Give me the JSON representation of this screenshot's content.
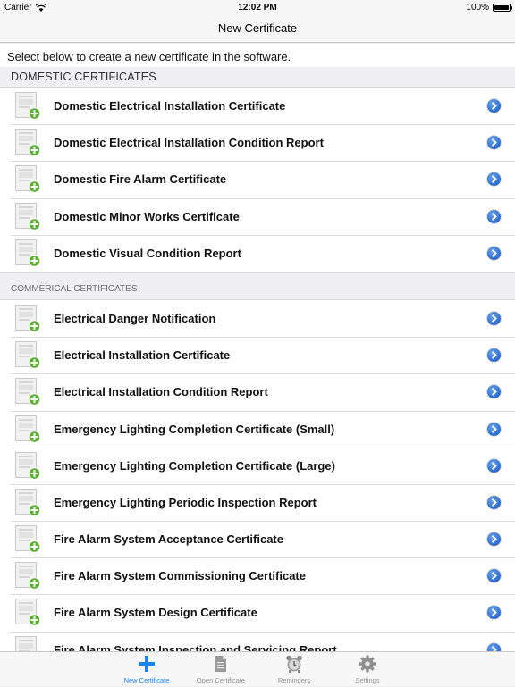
{
  "status_bar": {
    "carrier": "Carrier",
    "time": "12:02 PM",
    "battery": "100%"
  },
  "nav": {
    "title": "New Certificate"
  },
  "intro": "Select below to create a new certificate in the software.",
  "sections": [
    {
      "header": "DOMESTIC CERTIFICATES",
      "items": [
        "Domestic Electrical Installation Certificate",
        "Domestic Electrical Installation Condition Report",
        "Domestic Fire Alarm Certificate",
        "Domestic Minor Works Certificate",
        "Domestic Visual Condition Report"
      ]
    },
    {
      "header": "COMMERICAL CERTIFICATES",
      "items": [
        "Electrical Danger Notification",
        "Electrical Installation Certificate",
        "Electrical Installation Condition Report",
        "Emergency Lighting Completion Certificate (Small)",
        "Emergency Lighting Completion Certificate (Large)",
        "Emergency Lighting Periodic Inspection Report",
        "Fire Alarm System Acceptance Certificate",
        "Fire Alarm System Commissioning Certificate",
        "Fire Alarm System Design Certificate",
        "Fire Alarm System Inspection and Servicing Report"
      ]
    }
  ],
  "tabs": [
    {
      "label": "New Certificate",
      "icon": "plus-icon",
      "active": true
    },
    {
      "label": "Open Certificate",
      "icon": "document-icon",
      "active": false
    },
    {
      "label": "Reminders",
      "icon": "alarm-clock-icon",
      "active": false
    },
    {
      "label": "Settings",
      "icon": "gear-icon",
      "active": false
    }
  ],
  "colors": {
    "accent": "#1a82fb",
    "disclosure": "#2f6fd6",
    "add_badge": "#5ab030"
  }
}
